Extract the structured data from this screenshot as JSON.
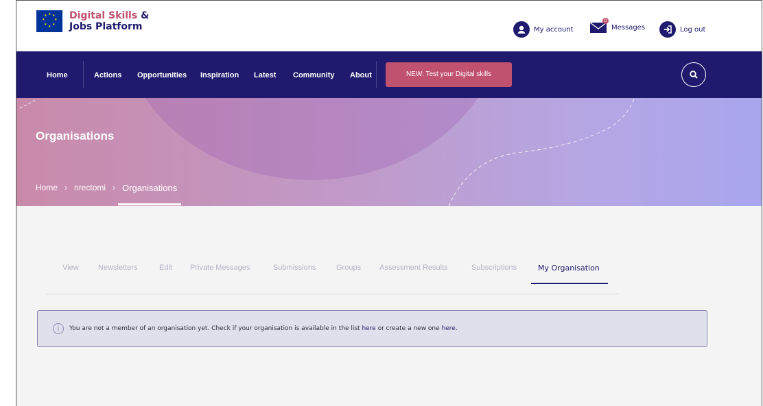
{
  "logo": {
    "line1": "Digital Skills",
    "amp": "&",
    "line2": "Jobs Platform"
  },
  "header": {
    "my_account": "My account",
    "messages": "Messages",
    "messages_badge": "0",
    "log_out": "Log out"
  },
  "nav": {
    "items": [
      "Home",
      "Actions",
      "Opportunities",
      "Inspiration",
      "Latest",
      "Community",
      "About"
    ],
    "cta": "NEW: Test your Digital skills"
  },
  "banner": {
    "title": "Organisations"
  },
  "breadcrumb": {
    "items": [
      "Home",
      "nrectomi",
      "Organisations"
    ],
    "separator": "›"
  },
  "tabs": [
    "View",
    "Newsletters",
    "Edit",
    "Private Messages",
    "Submissions",
    "Groups",
    "Assessment Results",
    "Subscriptions",
    "My Organisation"
  ],
  "notice": {
    "text_before": "You are not a member of an organisation yet. Check if your organisation is available in the list ",
    "link1": "here",
    "text_middle": " or create a new one ",
    "link2": "here",
    "text_after": "."
  },
  "colors": {
    "brand_navy": "#1f1a6d",
    "accent_pink": "#c0516f"
  }
}
